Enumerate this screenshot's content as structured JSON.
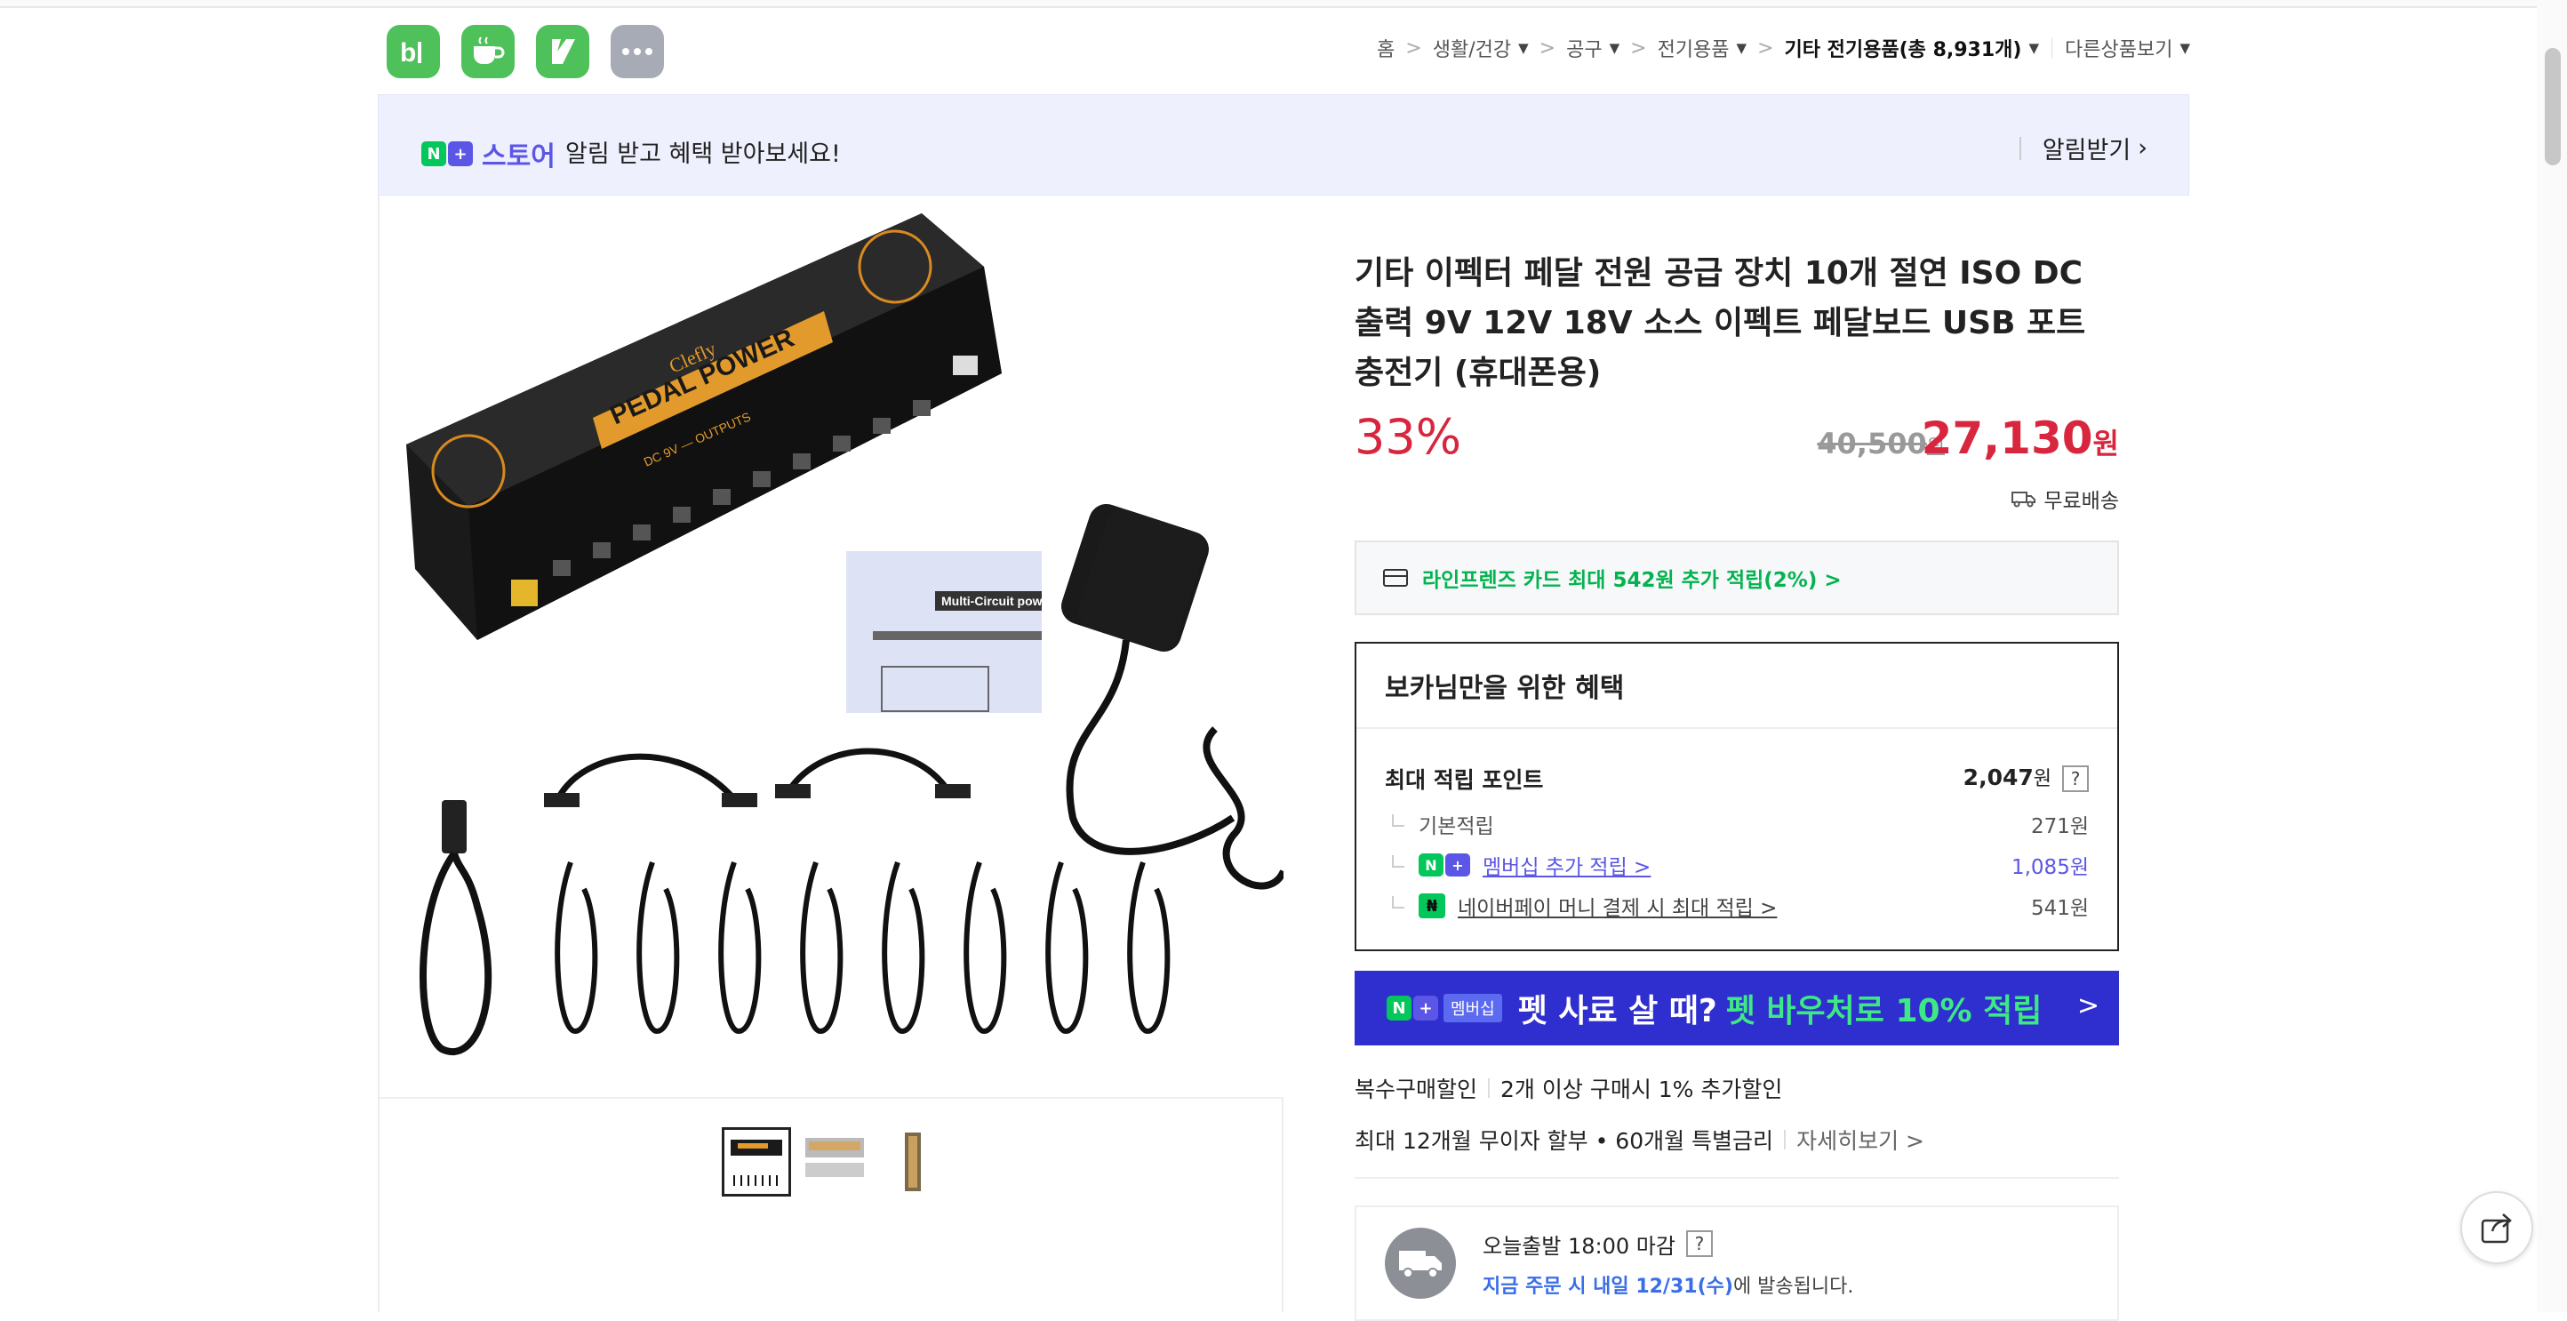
{
  "app_icons": [
    {
      "name": "band",
      "label": "b|"
    },
    {
      "name": "cafe",
      "label": "☕"
    },
    {
      "name": "kakao",
      "label": "K"
    },
    {
      "name": "more",
      "label": "•••"
    }
  ],
  "breadcrumb": {
    "items": [
      "홈",
      "생활/건강",
      "공구",
      "전기용품",
      "기타 전기용품(총 8,931개)"
    ],
    "other": "다른상품보기"
  },
  "promo": {
    "store_label": "스토어",
    "message": "알림 받고 혜택 받아보세요!",
    "subscribe_label": "알림받기",
    "brand_color": "#5c56e6"
  },
  "gallery": {
    "thumbnail_count": 3,
    "selected_index": 0,
    "product_text": {
      "brand": "Clefly",
      "name": "PEDAL POWER",
      "outputs": "DC 9V — OUTPUTS",
      "manual_title": "Multi-Circuit pow"
    }
  },
  "product": {
    "title": "기타 이펙터 페달 전원 공급 장치 10개 절연 ISO DC 출력 9V 12V 18V 소스 이펙트 페달보드 USB 포트 충전기 (휴대폰용)",
    "discount": "33%",
    "original_price": "40,500",
    "sale_price": "27,130",
    "currency": "원",
    "shipping": "무료배송"
  },
  "card_offer": "라인프렌즈 카드 최대 542원 추가 적립(2%) >",
  "benefit": {
    "heading": "보카님만을 위한 혜택",
    "max_points_label": "최대 적립 포인트",
    "max_points_value": "2,047",
    "unit": "원",
    "help": "?",
    "rows": [
      {
        "label": "기본적립",
        "value": "271원"
      },
      {
        "label": "멤버십 추가 적립 >",
        "value": "1,085원"
      },
      {
        "label": "네이버페이 머니 결제 시 최대 적립 >",
        "value": "541원"
      }
    ]
  },
  "membership_banner": {
    "badge": "멤버십",
    "text": "펫 사료 살 때?",
    "highlight": "펫 바우처로 10% 적립",
    "arrow": ">"
  },
  "multi_buy": {
    "label": "복수구매할인",
    "value": "2개 이상 구매시 1% 추가할인"
  },
  "installment": {
    "label": "최대 12개월 무이자 할부 • 60개월 특별금리",
    "more": "자세히보기 >"
  },
  "delivery": {
    "title": "오늘출발 18:00 마감",
    "help": "?",
    "highlight": "지금 주문 시 내일 12/31(수)",
    "suffix": "에 발송됩니다."
  },
  "colors": {
    "accent_red": "#d7263d",
    "naver_green": "#03c75a",
    "banner_blue": "#2f2ecf"
  }
}
